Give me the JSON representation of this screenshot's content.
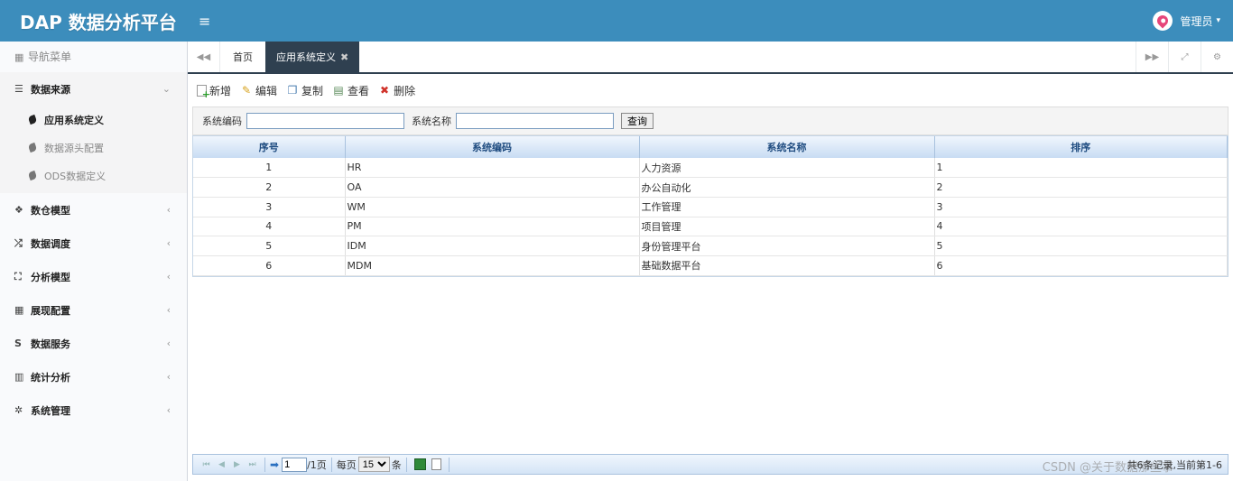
{
  "header": {
    "logo": "DAP 数据分析平台",
    "toggle_icon": "≡",
    "user_name": "管理员",
    "user_caret": "▾"
  },
  "sidebar": {
    "nav_header": "导航菜单",
    "menus": [
      {
        "label": "数据来源",
        "icon": "database-icon",
        "glyph": "☰",
        "arrow": "⌄",
        "open": true,
        "children": [
          {
            "label": "应用系统定义",
            "active": true
          },
          {
            "label": "数据源头配置",
            "active": false
          },
          {
            "label": "ODS数据定义",
            "active": false
          }
        ]
      },
      {
        "label": "数仓模型",
        "icon": "cubes-icon",
        "glyph": "❖",
        "arrow": "‹"
      },
      {
        "label": "数据调度",
        "icon": "random-icon",
        "glyph": "⤮",
        "arrow": "‹"
      },
      {
        "label": "分析模型",
        "icon": "object-group-icon",
        "glyph": "⛶",
        "arrow": "‹"
      },
      {
        "label": "展现配置",
        "icon": "film-icon",
        "glyph": "▦",
        "arrow": "‹"
      },
      {
        "label": "数据服务",
        "icon": "dollar-icon",
        "glyph": "S",
        "arrow": "‹"
      },
      {
        "label": "统计分析",
        "icon": "bar-chart-icon",
        "glyph": "▥",
        "arrow": "‹"
      },
      {
        "label": "系统管理",
        "icon": "gear-icon",
        "glyph": "✲",
        "arrow": "‹"
      }
    ]
  },
  "tabs": {
    "home": "首页",
    "active": "应用系统定义",
    "close": "✖",
    "left_nav": "◀◀",
    "right_nav": "▶▶",
    "fullscreen": "⤢",
    "settings": "⚙"
  },
  "toolbar": {
    "add": "新增",
    "edit": "编辑",
    "copy": "复制",
    "view": "查看",
    "delete": "删除",
    "edit_glyph": "✎",
    "copy_glyph": "❐",
    "view_glyph": "▤",
    "delete_glyph": "✖"
  },
  "search": {
    "code_label": "系统编码",
    "name_label": "系统名称",
    "code_value": "",
    "name_value": "",
    "query_button": "查询"
  },
  "grid": {
    "columns": [
      "序号",
      "系统编码",
      "系统名称",
      "排序"
    ],
    "rows": [
      [
        "1",
        "HR",
        "人力资源",
        "1"
      ],
      [
        "2",
        "OA",
        "办公自动化",
        "2"
      ],
      [
        "3",
        "WM",
        "工作管理",
        "3"
      ],
      [
        "4",
        "PM",
        "项目管理",
        "4"
      ],
      [
        "5",
        "IDM",
        "身份管理平台",
        "5"
      ],
      [
        "6",
        "MDM",
        "基础数据平台",
        "6"
      ]
    ]
  },
  "pager": {
    "first": "⏮",
    "prev": "◀",
    "next": "▶",
    "last": "⏭",
    "go": "➡",
    "page_value": "1",
    "total_pages": "/1页",
    "per_page_label": "每页",
    "per_page_value": "15",
    "unit": "条",
    "info": "共6条记录,当前第1-6",
    "watermark": "CSDN @关于数据那些事"
  }
}
